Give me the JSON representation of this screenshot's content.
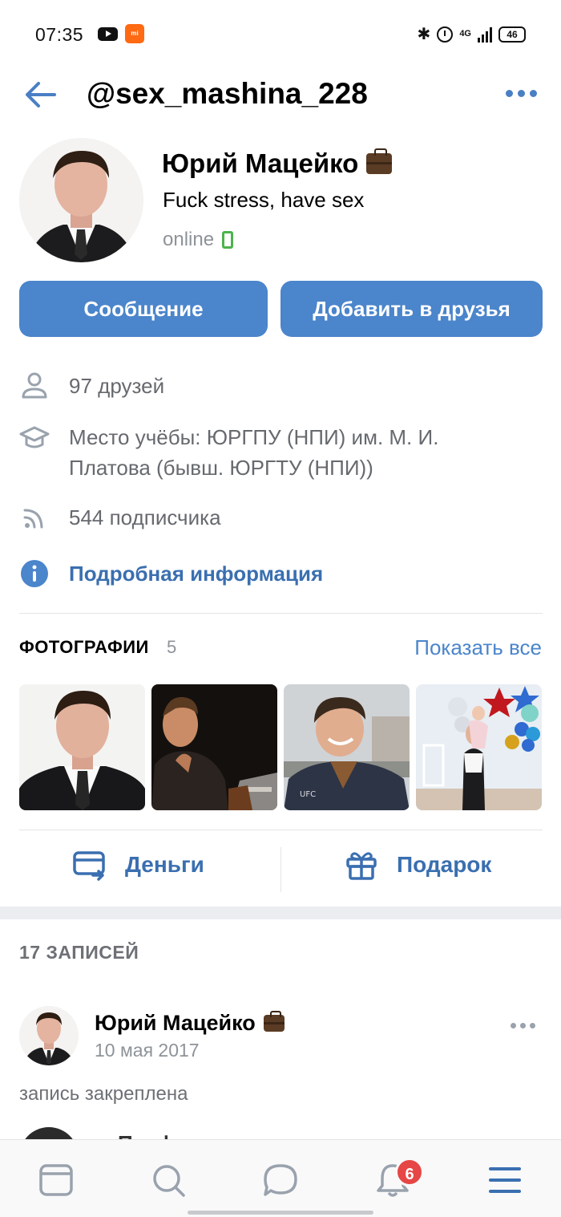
{
  "status_bar": {
    "time": "07:35",
    "network": "4G",
    "battery": "46",
    "bluetooth": "✱"
  },
  "header": {
    "title": "@sex_mashina_228",
    "back_icon": "arrow-left-icon",
    "more_icon": "more-horizontal-icon"
  },
  "profile": {
    "name": "Юрий Мацейко",
    "name_emoji": "briefcase-icon",
    "status": "Fuck stress, have sex",
    "online": "online"
  },
  "buttons": {
    "message": "Сообщение",
    "add_friend": "Добавить в друзья"
  },
  "info": {
    "friends": "97 друзей",
    "education": "Место учёбы: ЮРГПУ (НПИ) им. М. И.",
    "education_line2": "Платова (бывш. ЮРГТУ (НПИ))",
    "followers": "544 подписчика",
    "details": "Подробная информация"
  },
  "photos": {
    "title": "ФОТОГРАФИИ",
    "count": "5",
    "show_all": "Показать все"
  },
  "actions": {
    "money": "Деньги",
    "gift": "Подарок"
  },
  "posts": {
    "title": "17 ЗАПИСЕЙ",
    "author": "Юрий Мацейко",
    "date": "10 мая 2017",
    "pinned": "запись закреплена",
    "next_text": "Перфекционист"
  },
  "bottom_nav": {
    "items": [
      "news-icon",
      "search-icon",
      "messages-icon",
      "notifications-icon",
      "menu-icon"
    ],
    "notifications_badge": "6"
  },
  "colors": {
    "accent": "#4b85cb",
    "link": "#3a6fb0",
    "online": "#4bb34b",
    "badge": "#e64646",
    "secondary_text": "#66696e"
  }
}
